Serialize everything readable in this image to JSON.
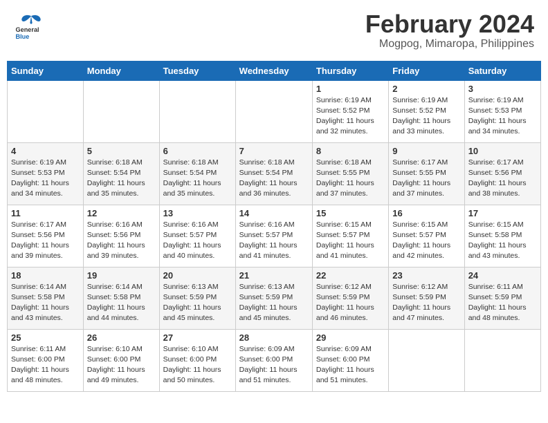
{
  "header": {
    "logo_general": "General",
    "logo_blue": "Blue",
    "title": "February 2024",
    "subtitle": "Mogpog, Mimaropa, Philippines"
  },
  "weekdays": [
    "Sunday",
    "Monday",
    "Tuesday",
    "Wednesday",
    "Thursday",
    "Friday",
    "Saturday"
  ],
  "weeks": [
    [
      {
        "day": "",
        "info": ""
      },
      {
        "day": "",
        "info": ""
      },
      {
        "day": "",
        "info": ""
      },
      {
        "day": "",
        "info": ""
      },
      {
        "day": "1",
        "info": "Sunrise: 6:19 AM\nSunset: 5:52 PM\nDaylight: 11 hours\nand 32 minutes."
      },
      {
        "day": "2",
        "info": "Sunrise: 6:19 AM\nSunset: 5:52 PM\nDaylight: 11 hours\nand 33 minutes."
      },
      {
        "day": "3",
        "info": "Sunrise: 6:19 AM\nSunset: 5:53 PM\nDaylight: 11 hours\nand 34 minutes."
      }
    ],
    [
      {
        "day": "4",
        "info": "Sunrise: 6:19 AM\nSunset: 5:53 PM\nDaylight: 11 hours\nand 34 minutes."
      },
      {
        "day": "5",
        "info": "Sunrise: 6:18 AM\nSunset: 5:54 PM\nDaylight: 11 hours\nand 35 minutes."
      },
      {
        "day": "6",
        "info": "Sunrise: 6:18 AM\nSunset: 5:54 PM\nDaylight: 11 hours\nand 35 minutes."
      },
      {
        "day": "7",
        "info": "Sunrise: 6:18 AM\nSunset: 5:54 PM\nDaylight: 11 hours\nand 36 minutes."
      },
      {
        "day": "8",
        "info": "Sunrise: 6:18 AM\nSunset: 5:55 PM\nDaylight: 11 hours\nand 37 minutes."
      },
      {
        "day": "9",
        "info": "Sunrise: 6:17 AM\nSunset: 5:55 PM\nDaylight: 11 hours\nand 37 minutes."
      },
      {
        "day": "10",
        "info": "Sunrise: 6:17 AM\nSunset: 5:56 PM\nDaylight: 11 hours\nand 38 minutes."
      }
    ],
    [
      {
        "day": "11",
        "info": "Sunrise: 6:17 AM\nSunset: 5:56 PM\nDaylight: 11 hours\nand 39 minutes."
      },
      {
        "day": "12",
        "info": "Sunrise: 6:16 AM\nSunset: 5:56 PM\nDaylight: 11 hours\nand 39 minutes."
      },
      {
        "day": "13",
        "info": "Sunrise: 6:16 AM\nSunset: 5:57 PM\nDaylight: 11 hours\nand 40 minutes."
      },
      {
        "day": "14",
        "info": "Sunrise: 6:16 AM\nSunset: 5:57 PM\nDaylight: 11 hours\nand 41 minutes."
      },
      {
        "day": "15",
        "info": "Sunrise: 6:15 AM\nSunset: 5:57 PM\nDaylight: 11 hours\nand 41 minutes."
      },
      {
        "day": "16",
        "info": "Sunrise: 6:15 AM\nSunset: 5:57 PM\nDaylight: 11 hours\nand 42 minutes."
      },
      {
        "day": "17",
        "info": "Sunrise: 6:15 AM\nSunset: 5:58 PM\nDaylight: 11 hours\nand 43 minutes."
      }
    ],
    [
      {
        "day": "18",
        "info": "Sunrise: 6:14 AM\nSunset: 5:58 PM\nDaylight: 11 hours\nand 43 minutes."
      },
      {
        "day": "19",
        "info": "Sunrise: 6:14 AM\nSunset: 5:58 PM\nDaylight: 11 hours\nand 44 minutes."
      },
      {
        "day": "20",
        "info": "Sunrise: 6:13 AM\nSunset: 5:59 PM\nDaylight: 11 hours\nand 45 minutes."
      },
      {
        "day": "21",
        "info": "Sunrise: 6:13 AM\nSunset: 5:59 PM\nDaylight: 11 hours\nand 45 minutes."
      },
      {
        "day": "22",
        "info": "Sunrise: 6:12 AM\nSunset: 5:59 PM\nDaylight: 11 hours\nand 46 minutes."
      },
      {
        "day": "23",
        "info": "Sunrise: 6:12 AM\nSunset: 5:59 PM\nDaylight: 11 hours\nand 47 minutes."
      },
      {
        "day": "24",
        "info": "Sunrise: 6:11 AM\nSunset: 5:59 PM\nDaylight: 11 hours\nand 48 minutes."
      }
    ],
    [
      {
        "day": "25",
        "info": "Sunrise: 6:11 AM\nSunset: 6:00 PM\nDaylight: 11 hours\nand 48 minutes."
      },
      {
        "day": "26",
        "info": "Sunrise: 6:10 AM\nSunset: 6:00 PM\nDaylight: 11 hours\nand 49 minutes."
      },
      {
        "day": "27",
        "info": "Sunrise: 6:10 AM\nSunset: 6:00 PM\nDaylight: 11 hours\nand 50 minutes."
      },
      {
        "day": "28",
        "info": "Sunrise: 6:09 AM\nSunset: 6:00 PM\nDaylight: 11 hours\nand 51 minutes."
      },
      {
        "day": "29",
        "info": "Sunrise: 6:09 AM\nSunset: 6:00 PM\nDaylight: 11 hours\nand 51 minutes."
      },
      {
        "day": "",
        "info": ""
      },
      {
        "day": "",
        "info": ""
      }
    ]
  ]
}
